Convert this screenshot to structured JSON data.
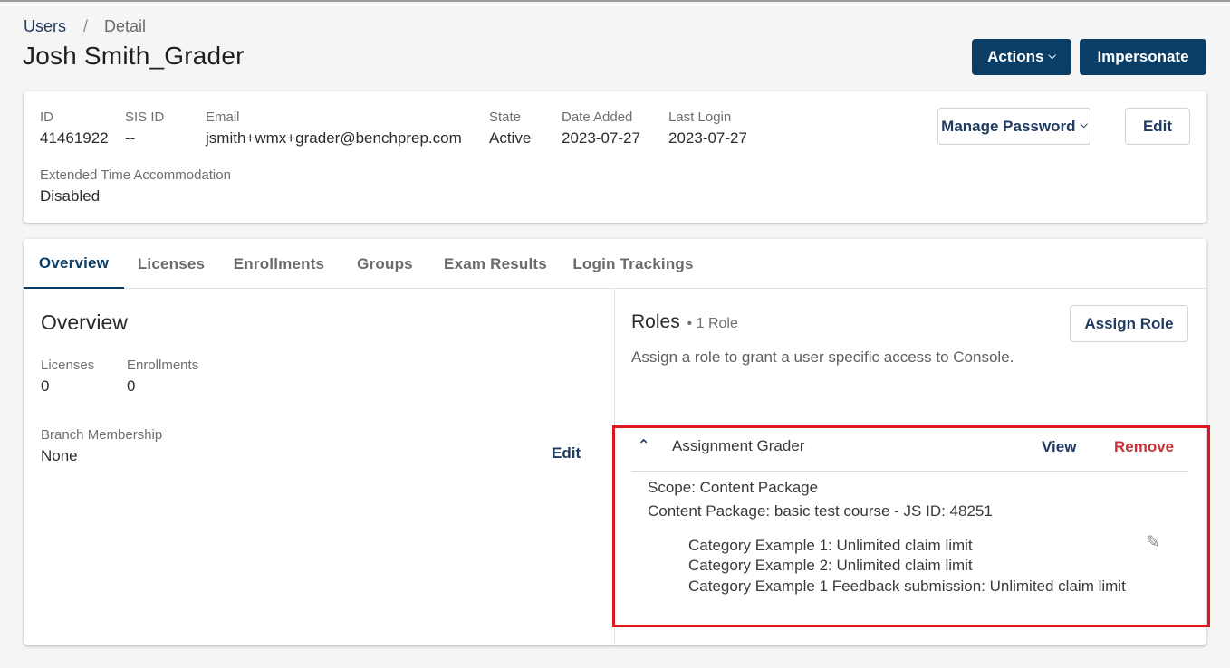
{
  "breadcrumb": {
    "parent": "Users",
    "separator": "/",
    "current": "Detail"
  },
  "page_title": "Josh Smith_Grader",
  "header_actions": {
    "actions_label": "Actions",
    "impersonate_label": "Impersonate"
  },
  "user_info": {
    "id_label": "ID",
    "id_value": "41461922",
    "sis_label": "SIS ID",
    "sis_value": "--",
    "email_label": "Email",
    "email_value": "jsmith+wmx+grader@benchprep.com",
    "state_label": "State",
    "state_value": "Active",
    "date_added_label": "Date Added",
    "date_added_value": "2023-07-27",
    "last_login_label": "Last Login",
    "last_login_value": "2023-07-27",
    "eta_label": "Extended Time Accommodation",
    "eta_value": "Disabled",
    "manage_password_label": "Manage Password",
    "edit_label": "Edit"
  },
  "tabs": [
    {
      "label": "Overview"
    },
    {
      "label": "Licenses"
    },
    {
      "label": "Enrollments"
    },
    {
      "label": "Groups"
    },
    {
      "label": "Exam Results"
    },
    {
      "label": "Login Trackings"
    }
  ],
  "overview": {
    "title": "Overview",
    "licenses_label": "Licenses",
    "licenses_value": "0",
    "enrollments_label": "Enrollments",
    "enrollments_value": "0",
    "branch_label": "Branch Membership",
    "branch_value": "None",
    "edit_label": "Edit"
  },
  "roles": {
    "title": "Roles",
    "count": "• 1 Role",
    "description": "Assign a role to grant a user specific access to Console.",
    "assign_label": "Assign Role",
    "items": [
      {
        "name": "Assignment Grader",
        "view_label": "View",
        "remove_label": "Remove",
        "scope": "Scope: Content Package",
        "content_package": "Content Package: basic test course - JS ID: 48251",
        "categories": [
          "Category Example 1: Unlimited claim limit",
          "Category Example 2: Unlimited claim limit",
          "Category Example 1 Feedback submission: Unlimited claim limit"
        ]
      }
    ]
  },
  "icons": {
    "chevron_down": "chevron-down-icon",
    "chevron_up": "chevron-up-icon",
    "pencil": "pencil-icon"
  },
  "colors": {
    "primary": "#0b3e66",
    "link": "#1f3a5f",
    "danger": "#c8333a",
    "highlight_border": "#e0161f"
  }
}
